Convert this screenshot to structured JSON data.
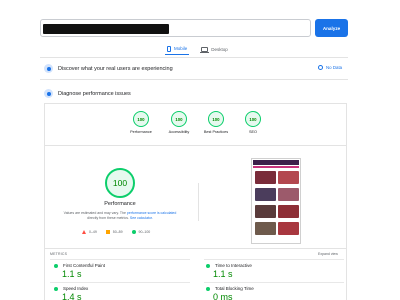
{
  "search": {
    "value": "",
    "button_label": "Analyze"
  },
  "tabs": [
    {
      "label": "Mobile",
      "icon": "mobile-icon",
      "active": true
    },
    {
      "label": "Desktop",
      "icon": "desktop-icon",
      "active": false
    }
  ],
  "field_data": {
    "text": "Discover what your real users are experiencing",
    "status": "No Data"
  },
  "diagnose": {
    "text": "Diagnose performance issues"
  },
  "scores": [
    {
      "value": "100",
      "label": "Performance"
    },
    {
      "value": "100",
      "label": "Accessibility"
    },
    {
      "value": "100",
      "label": "Best Practices"
    },
    {
      "value": "100",
      "label": "SEO"
    }
  ],
  "performance": {
    "score": "100",
    "title": "Performance",
    "desc_1": "Values are estimated and may vary. The",
    "desc_link_1": "performance score is calculated",
    "desc_2": "directly from these metrics.",
    "desc_link_2": "See calculator."
  },
  "legend": [
    {
      "label": "0–49",
      "color": "#ff4e42"
    },
    {
      "label": "50–89",
      "color": "#ffa400"
    },
    {
      "label": "90–100",
      "color": "#0cce6b"
    }
  ],
  "metrics": {
    "header": "METRICS",
    "expand": "Expand view",
    "items": [
      {
        "label": "First Contentful Paint",
        "value": "1.1 s"
      },
      {
        "label": "Time to Interactive",
        "value": "1.1 s"
      },
      {
        "label": "Speed Index",
        "value": "1.4 s"
      },
      {
        "label": "Total Blocking Time",
        "value": "0 ms"
      }
    ]
  },
  "colors": {
    "accent": "#1a73e8",
    "pass": "#0cce6b",
    "pass_text": "#008800"
  }
}
